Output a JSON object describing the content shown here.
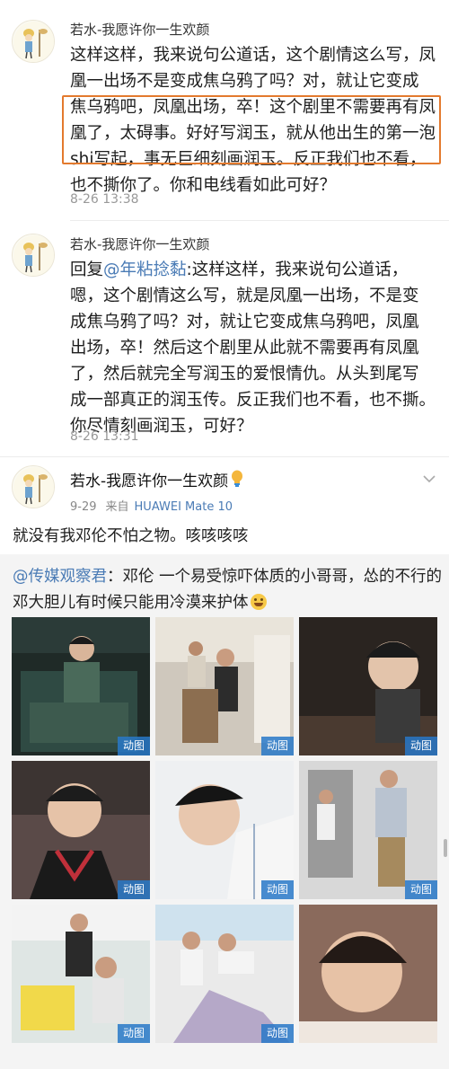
{
  "comments": [
    {
      "username": "若水-我愿许你一生欢颜",
      "lines": [
        "这样这样，我来说句公道话，这个剧情这么写，凤",
        "凰一出场不是变成焦乌鸦了吗？对，就让它变成",
        "焦乌鸦吧，凤凰出场，卒！这个剧里不需要再有凤",
        "凰了，太碍事。好好写润玉，就从他出生的第一泡",
        "shi写起，事无巨细刻画润玉。反正我们也不看，",
        "也不撕你了。你和电线看如此可好？"
      ],
      "time": "8-26 13:38"
    },
    {
      "username": "若水-我愿许你一生欢颜",
      "reply_prefix": "回复",
      "reply_to": "@年粘捻黏",
      "first_line_rest": ":这样这样，我来说句公道话，",
      "lines": [
        "嗯，这个剧情这么写，就是凤凰一出场，不是变",
        "成焦乌鸦了吗？对，就让它变成焦乌鸦吧，凤凰",
        "出场，卒！然后这个剧里从此就不需要再有凤凰",
        "了，然后就完全写润玉的爱恨情仇。从头到尾写",
        "成一部真正的润玉传。反正我们也不看，也不撕。",
        "你尽情刻画润玉，可好？"
      ],
      "time": "8-26 13:31"
    }
  ],
  "post": {
    "username": "若水-我愿许你一生欢颜",
    "date": "9-29",
    "source_label": "来自",
    "device": "HUAWEI Mate 10",
    "text": "就没有我邓伦不怕之物。咳咳咳咳",
    "repost": {
      "author": "@传媒观察君",
      "line1_rest": "：邓伦 一个易受惊吓体质的小哥哥，怂的不行的",
      "line2": "邓大胆儿有时候只能用冷漠来护体",
      "gif_label": "动图"
    }
  },
  "colors": {
    "link": "#4a7bb5",
    "highlight_border": "#e37a2e",
    "gif_badge": "#2878c8",
    "repost_bg": "#f4f4f4"
  },
  "icons": [
    "avatar",
    "lightbulb-icon",
    "chevron-down-icon",
    "laugh-emoji-icon"
  ]
}
